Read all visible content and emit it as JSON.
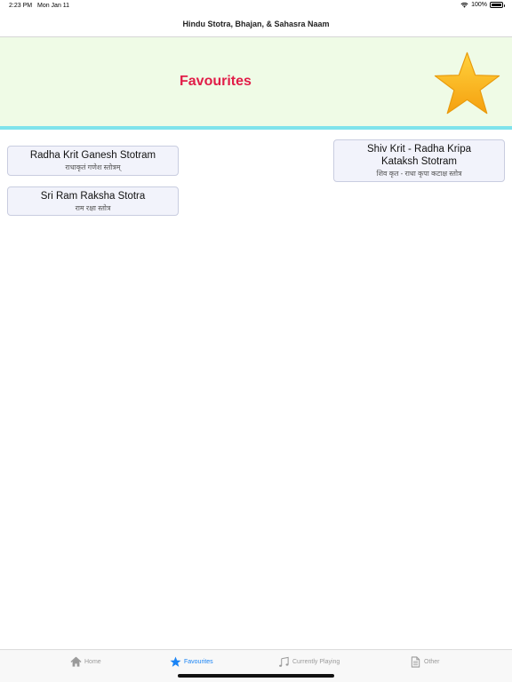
{
  "status_bar": {
    "time": "2:23 PM",
    "date": "Mon Jan 11",
    "battery": "100%",
    "battery_level": 1.0
  },
  "nav": {
    "title": "Hindu Stotra, Bhajan, & Sahasra Naam"
  },
  "banner": {
    "title": "Favourites",
    "icon": "star-icon"
  },
  "favourites": [
    {
      "title": "Radha Krit Ganesh Stotram",
      "subtitle": "राधाकृतं गणेश स्तोत्रम्"
    },
    {
      "title": "Sri Ram Raksha Stotra",
      "subtitle": "राम रक्षा स्तोत्र"
    },
    {
      "title_line1": "Shiv Krit - Radha Kripa",
      "title_line2": "Kataksh Stotram",
      "subtitle": "शिव कृत - राधा कृपा कटाक्ष स्तोत्र"
    }
  ],
  "tabs": [
    {
      "label": "Home",
      "icon": "home-icon",
      "active": false
    },
    {
      "label": "Favourites",
      "icon": "star-icon",
      "active": true
    },
    {
      "label": "Currently Playing",
      "icon": "music-notes-icon",
      "active": false
    },
    {
      "label": "Other",
      "icon": "document-icon",
      "active": false
    }
  ],
  "colors": {
    "accent": "#1a84f5",
    "banner_bg": "#effbe6",
    "banner_title": "#e11d48",
    "divider": "#7fe3ec",
    "star": "#f9b316"
  }
}
